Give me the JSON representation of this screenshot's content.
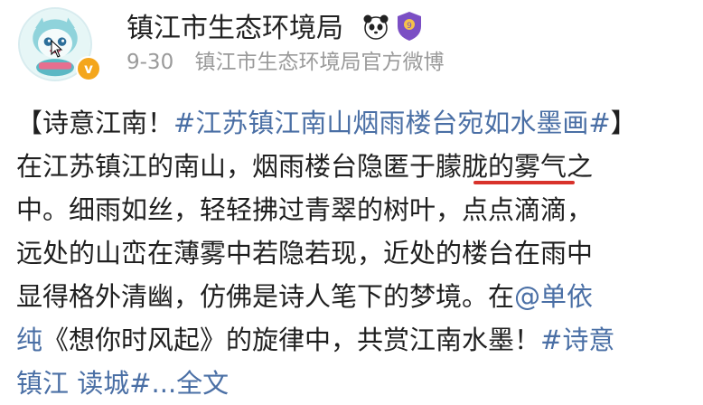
{
  "account": {
    "name": "镇江市生态环境局",
    "date": "9-30",
    "source": "镇江市生态环境局官方微博",
    "badges": [
      "panda-icon",
      "shield-badge-icon"
    ],
    "verified_color": "#f4a61c"
  },
  "post": {
    "line1": {
      "open": "【诗意江南！",
      "tag": "#江苏镇江南山烟雨楼台宛如水墨画#",
      "close": "】"
    },
    "line2": {
      "a": "在江苏镇江的南山，烟雨楼台隐匿",
      "b": "于朦胧",
      "c": "的雾气之"
    },
    "line3": "中。细雨如丝，轻轻拂过青翠的树叶，点点滴滴，",
    "line4": "远处的山峦在薄雾中若隐若现，近处的楼台在雨中",
    "line5": {
      "text": "显得格外清幽，仿佛是诗人笔下的梦境。在",
      "mention": "@单依"
    },
    "line6": {
      "mention": "纯",
      "text": "《想你时风起》的旋律中，共赏江南水墨！",
      "tag": "#诗意"
    },
    "line7": {
      "tag": "镇江 读城#",
      "more": "...全文"
    }
  },
  "colors": {
    "link": "#4a6fa5",
    "underline": "#d8322b",
    "meta": "#9a9a9a"
  }
}
